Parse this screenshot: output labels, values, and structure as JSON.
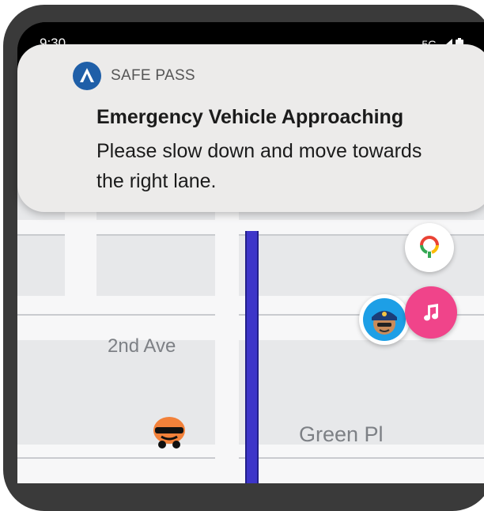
{
  "status_bar": {
    "time": "9:30",
    "network": "5G"
  },
  "notification": {
    "app_name": "SAFE PASS",
    "title": "Emergency Vehicle Approaching",
    "body": "Please slow down and move towards the right lane."
  },
  "map": {
    "street_labels": [
      "2nd Ave",
      "Green Pl"
    ],
    "route_color": "#3d35c9"
  },
  "colors": {
    "app_icon": "#1f5fa8",
    "music_button": "#f0448a",
    "police_badge": "#1d9fe6"
  }
}
